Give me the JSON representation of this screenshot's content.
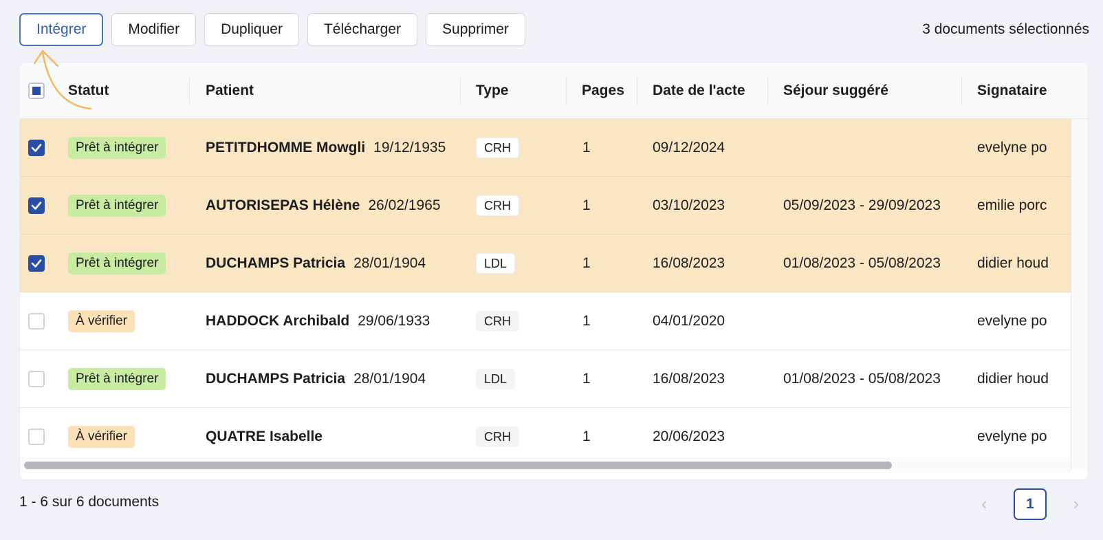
{
  "toolbar": {
    "integrer": "Intégrer",
    "modifier": "Modifier",
    "dupliquer": "Dupliquer",
    "telecharger": "Télécharger",
    "supprimer": "Supprimer"
  },
  "selection_text": "3 documents sélectionnés",
  "columns": {
    "statut": "Statut",
    "patient": "Patient",
    "type": "Type",
    "pages": "Pages",
    "date": "Date de l'acte",
    "sejour": "Séjour suggéré",
    "signataire": "Signataire"
  },
  "rows": [
    {
      "checked": true,
      "status": "Prêt à intégrer",
      "status_kind": "ready",
      "name": "PETITDHOMME Mowgli",
      "dob": "19/12/1935",
      "type": "CRH",
      "pages": "1",
      "date": "09/12/2024",
      "sejour": "",
      "signataire": "evelyne po"
    },
    {
      "checked": true,
      "status": "Prêt à intégrer",
      "status_kind": "ready",
      "name": "AUTORISEPAS Hélène",
      "dob": "26/02/1965",
      "type": "CRH",
      "pages": "1",
      "date": "03/10/2023",
      "sejour": "05/09/2023 - 29/09/2023",
      "signataire": "emilie porc"
    },
    {
      "checked": true,
      "status": "Prêt à intégrer",
      "status_kind": "ready",
      "name": "DUCHAMPS Patricia",
      "dob": "28/01/1904",
      "type": "LDL",
      "pages": "1",
      "date": "16/08/2023",
      "sejour": "01/08/2023 - 05/08/2023",
      "signataire": "didier houd"
    },
    {
      "checked": false,
      "status": "À vérifier",
      "status_kind": "check",
      "name": "HADDOCK Archibald",
      "dob": "29/06/1933",
      "type": "CRH",
      "pages": "1",
      "date": "04/01/2020",
      "sejour": "",
      "signataire": "evelyne po"
    },
    {
      "checked": false,
      "status": "Prêt à intégrer",
      "status_kind": "ready",
      "name": "DUCHAMPS Patricia",
      "dob": "28/01/1904",
      "type": "LDL",
      "pages": "1",
      "date": "16/08/2023",
      "sejour": "01/08/2023 - 05/08/2023",
      "signataire": "didier houd"
    },
    {
      "checked": false,
      "status": "À vérifier",
      "status_kind": "check",
      "name": "QUATRE Isabelle",
      "dob": "",
      "type": "CRH",
      "pages": "1",
      "date": "20/06/2023",
      "sejour": "",
      "signataire": "evelyne po"
    }
  ],
  "footer": {
    "count_text": "1 - 6 sur 6 documents",
    "current_page": "1",
    "prev_icon": "chevron-left-icon",
    "next_icon": "chevron-right-icon"
  },
  "colors": {
    "accent": "#2a4ea5",
    "selected_row": "#fbe6c3",
    "ready_badge": "#c6eba1",
    "check_badge": "#fbe2b6",
    "annotation": "#f5b85a"
  }
}
